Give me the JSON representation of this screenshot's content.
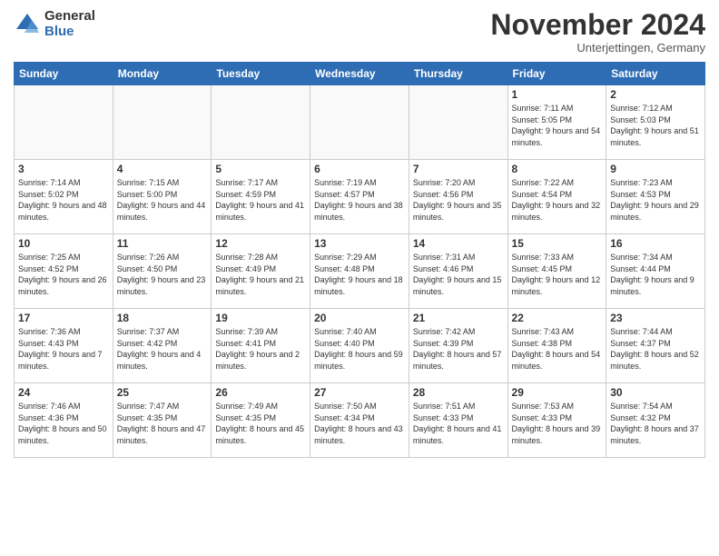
{
  "logo": {
    "general": "General",
    "blue": "Blue"
  },
  "title": "November 2024",
  "subtitle": "Unterjettingen, Germany",
  "weekdays": [
    "Sunday",
    "Monday",
    "Tuesday",
    "Wednesday",
    "Thursday",
    "Friday",
    "Saturday"
  ],
  "weeks": [
    [
      {
        "day": "",
        "info": ""
      },
      {
        "day": "",
        "info": ""
      },
      {
        "day": "",
        "info": ""
      },
      {
        "day": "",
        "info": ""
      },
      {
        "day": "",
        "info": ""
      },
      {
        "day": "1",
        "info": "Sunrise: 7:11 AM\nSunset: 5:05 PM\nDaylight: 9 hours and 54 minutes."
      },
      {
        "day": "2",
        "info": "Sunrise: 7:12 AM\nSunset: 5:03 PM\nDaylight: 9 hours and 51 minutes."
      }
    ],
    [
      {
        "day": "3",
        "info": "Sunrise: 7:14 AM\nSunset: 5:02 PM\nDaylight: 9 hours and 48 minutes."
      },
      {
        "day": "4",
        "info": "Sunrise: 7:15 AM\nSunset: 5:00 PM\nDaylight: 9 hours and 44 minutes."
      },
      {
        "day": "5",
        "info": "Sunrise: 7:17 AM\nSunset: 4:59 PM\nDaylight: 9 hours and 41 minutes."
      },
      {
        "day": "6",
        "info": "Sunrise: 7:19 AM\nSunset: 4:57 PM\nDaylight: 9 hours and 38 minutes."
      },
      {
        "day": "7",
        "info": "Sunrise: 7:20 AM\nSunset: 4:56 PM\nDaylight: 9 hours and 35 minutes."
      },
      {
        "day": "8",
        "info": "Sunrise: 7:22 AM\nSunset: 4:54 PM\nDaylight: 9 hours and 32 minutes."
      },
      {
        "day": "9",
        "info": "Sunrise: 7:23 AM\nSunset: 4:53 PM\nDaylight: 9 hours and 29 minutes."
      }
    ],
    [
      {
        "day": "10",
        "info": "Sunrise: 7:25 AM\nSunset: 4:52 PM\nDaylight: 9 hours and 26 minutes."
      },
      {
        "day": "11",
        "info": "Sunrise: 7:26 AM\nSunset: 4:50 PM\nDaylight: 9 hours and 23 minutes."
      },
      {
        "day": "12",
        "info": "Sunrise: 7:28 AM\nSunset: 4:49 PM\nDaylight: 9 hours and 21 minutes."
      },
      {
        "day": "13",
        "info": "Sunrise: 7:29 AM\nSunset: 4:48 PM\nDaylight: 9 hours and 18 minutes."
      },
      {
        "day": "14",
        "info": "Sunrise: 7:31 AM\nSunset: 4:46 PM\nDaylight: 9 hours and 15 minutes."
      },
      {
        "day": "15",
        "info": "Sunrise: 7:33 AM\nSunset: 4:45 PM\nDaylight: 9 hours and 12 minutes."
      },
      {
        "day": "16",
        "info": "Sunrise: 7:34 AM\nSunset: 4:44 PM\nDaylight: 9 hours and 9 minutes."
      }
    ],
    [
      {
        "day": "17",
        "info": "Sunrise: 7:36 AM\nSunset: 4:43 PM\nDaylight: 9 hours and 7 minutes."
      },
      {
        "day": "18",
        "info": "Sunrise: 7:37 AM\nSunset: 4:42 PM\nDaylight: 9 hours and 4 minutes."
      },
      {
        "day": "19",
        "info": "Sunrise: 7:39 AM\nSunset: 4:41 PM\nDaylight: 9 hours and 2 minutes."
      },
      {
        "day": "20",
        "info": "Sunrise: 7:40 AM\nSunset: 4:40 PM\nDaylight: 8 hours and 59 minutes."
      },
      {
        "day": "21",
        "info": "Sunrise: 7:42 AM\nSunset: 4:39 PM\nDaylight: 8 hours and 57 minutes."
      },
      {
        "day": "22",
        "info": "Sunrise: 7:43 AM\nSunset: 4:38 PM\nDaylight: 8 hours and 54 minutes."
      },
      {
        "day": "23",
        "info": "Sunrise: 7:44 AM\nSunset: 4:37 PM\nDaylight: 8 hours and 52 minutes."
      }
    ],
    [
      {
        "day": "24",
        "info": "Sunrise: 7:46 AM\nSunset: 4:36 PM\nDaylight: 8 hours and 50 minutes."
      },
      {
        "day": "25",
        "info": "Sunrise: 7:47 AM\nSunset: 4:35 PM\nDaylight: 8 hours and 47 minutes."
      },
      {
        "day": "26",
        "info": "Sunrise: 7:49 AM\nSunset: 4:35 PM\nDaylight: 8 hours and 45 minutes."
      },
      {
        "day": "27",
        "info": "Sunrise: 7:50 AM\nSunset: 4:34 PM\nDaylight: 8 hours and 43 minutes."
      },
      {
        "day": "28",
        "info": "Sunrise: 7:51 AM\nSunset: 4:33 PM\nDaylight: 8 hours and 41 minutes."
      },
      {
        "day": "29",
        "info": "Sunrise: 7:53 AM\nSunset: 4:33 PM\nDaylight: 8 hours and 39 minutes."
      },
      {
        "day": "30",
        "info": "Sunrise: 7:54 AM\nSunset: 4:32 PM\nDaylight: 8 hours and 37 minutes."
      }
    ]
  ]
}
